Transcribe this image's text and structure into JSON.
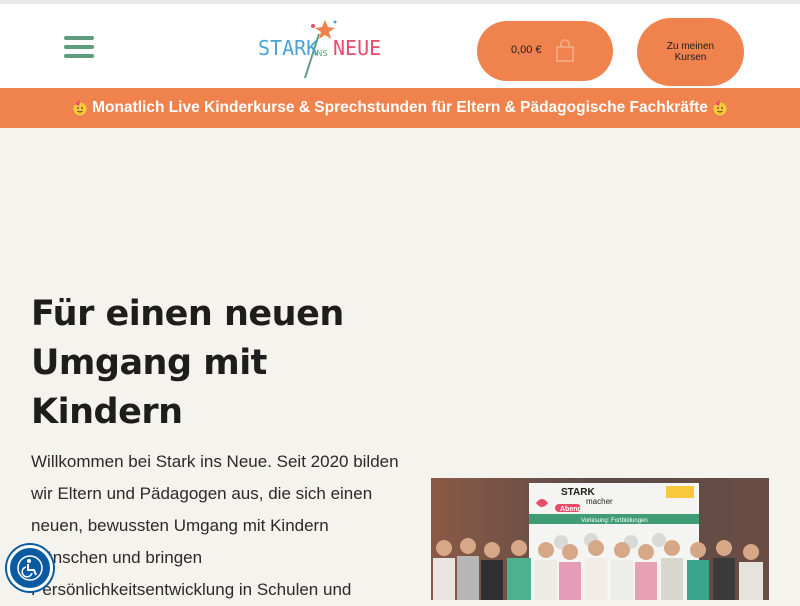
{
  "header": {
    "logo_text": {
      "stark": "STARK",
      "ins": "INS",
      "neue": "NEUE"
    },
    "cart": {
      "price": "0,00 €",
      "icon": "shopping-bag-icon"
    },
    "courses_button": "Zu meinen Kursen",
    "menu_icon": "hamburger-menu-icon"
  },
  "banner": {
    "text": "Monatlich Live Kinderkurse & Sprechstunden für Eltern & Pädagogische Fachkräfte",
    "icon": "party-face-emoji"
  },
  "hero": {
    "title": "Für einen neuen Umgang mit Kindern",
    "intro": "Willkommen bei Stark ins Neue. Seit 2020 bilden wir Eltern und Pädagogen aus, die sich einen neuen, bewussten Umgang mit Kindern wünschen und bringen Persönlichkeitsentwicklung in Schulen und"
  },
  "photo": {
    "screen_logo": {
      "stark": "STARK",
      "macher": "macher",
      "abend": "Abend"
    },
    "screen_caption": "Vorlesung: Fortbildungen"
  },
  "accessibility": {
    "icon": "accessibility-wheelchair-icon"
  },
  "colors": {
    "accent_orange": "#f0834d",
    "brand_green": "#5f9c7e",
    "background": "#f5f3ee",
    "accessibility_blue": "#0b5aa0"
  }
}
